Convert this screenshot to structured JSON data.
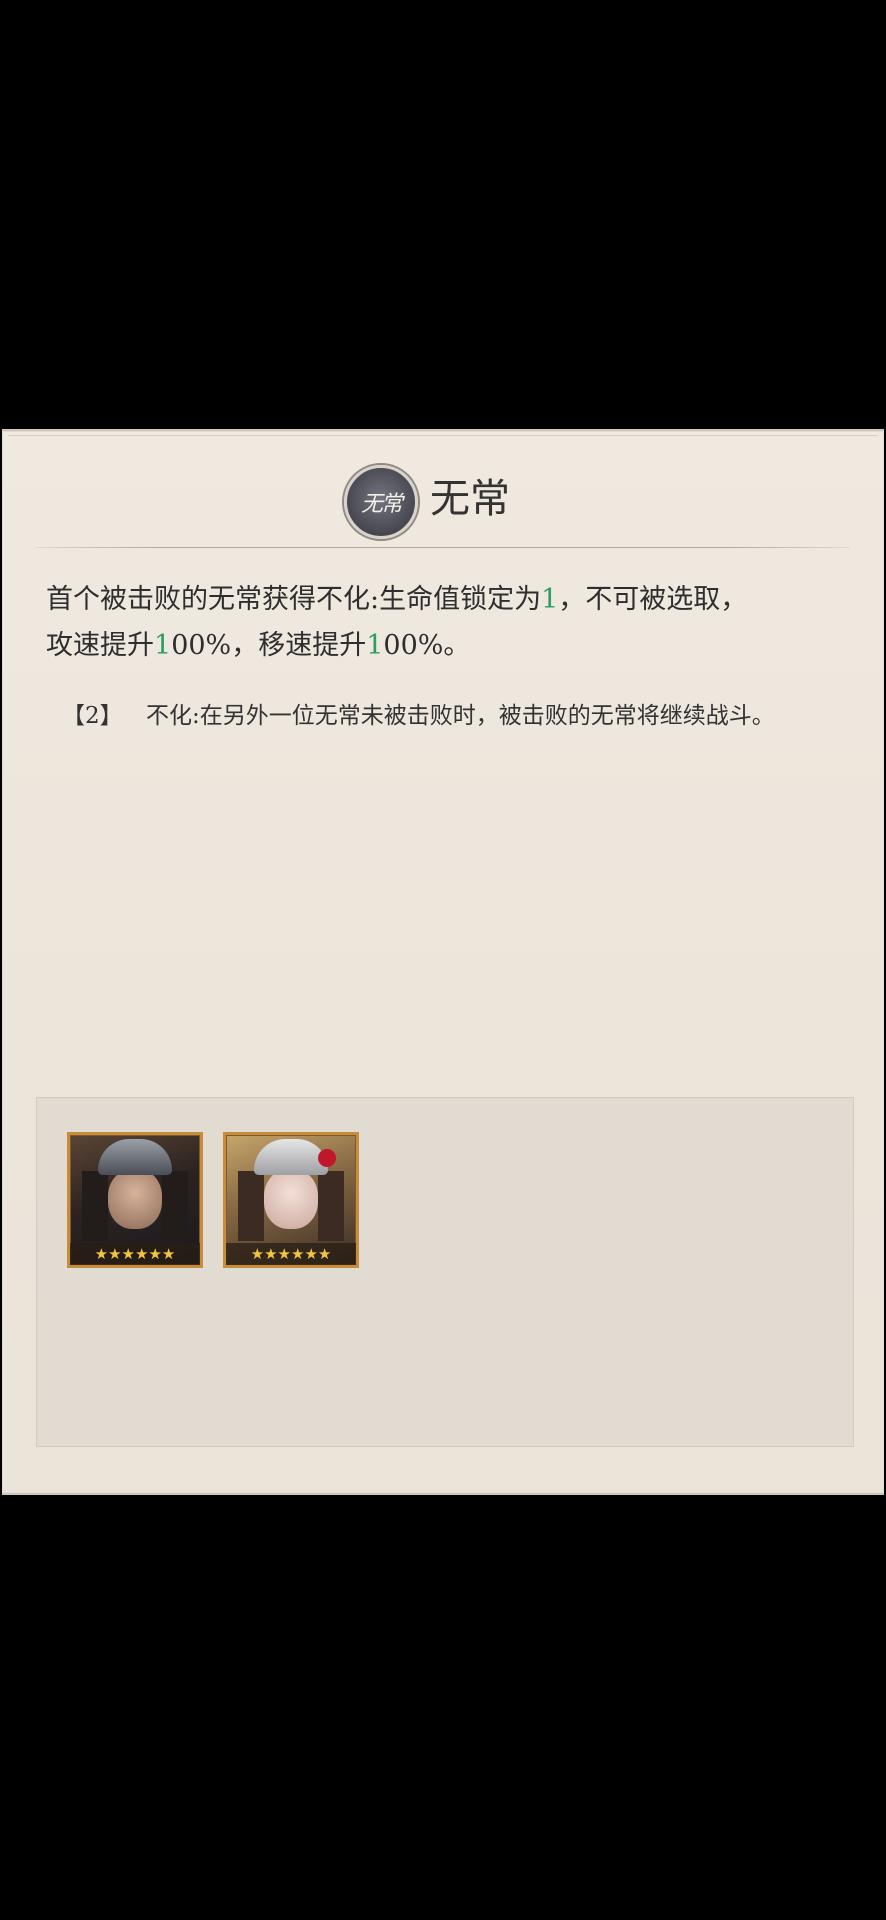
{
  "header": {
    "emblem_text": "无常",
    "title": "无常"
  },
  "description": {
    "line1_a": "首个被击败的无常获得不化:生命值锁定为",
    "line1_hl": "1",
    "line1_b": "，不可被选取，",
    "line2_a": "攻速提升",
    "line2_hl1": "1",
    "line2_b": "00%，移速提升",
    "line2_hl2": "1",
    "line2_c": "00%。"
  },
  "note": {
    "tag": "【2】",
    "text": "不化:在另外一位无常未被击败时，被击败的无常将继续战斗。"
  },
  "heroes": [
    {
      "name_icon": "hero-portrait-male",
      "stars": "★★★★★★"
    },
    {
      "name_icon": "hero-portrait-female",
      "stars": "★★★★★★"
    }
  ],
  "colors": {
    "highlight": "#2f9c63",
    "star": "#f3c443",
    "card_border": "#c88d3c"
  }
}
